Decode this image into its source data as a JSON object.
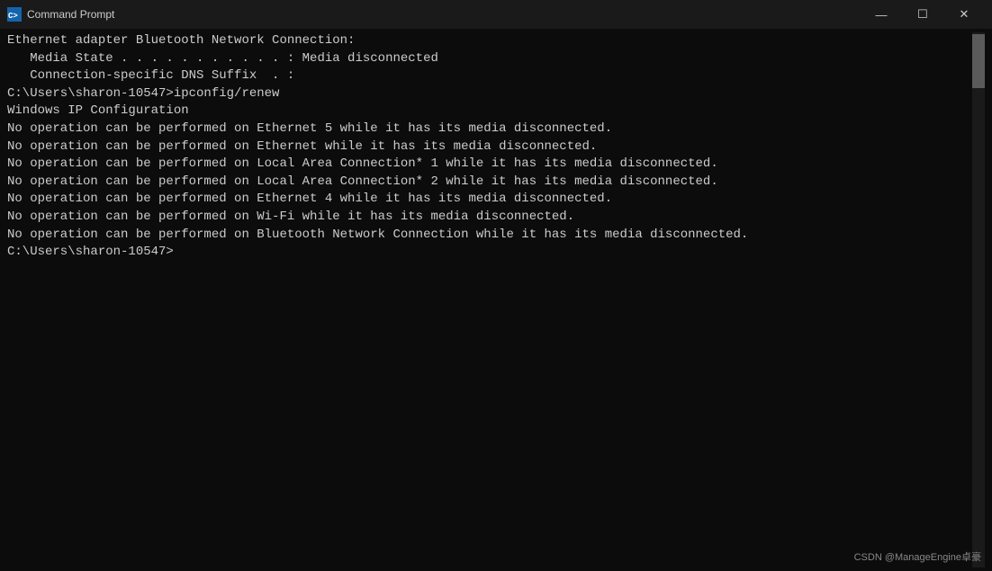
{
  "titleBar": {
    "icon": "cmd-icon",
    "title": "Command Prompt",
    "minimizeLabel": "—",
    "maximizeLabel": "☐",
    "closeLabel": "✕"
  },
  "terminal": {
    "lines": [
      "Ethernet adapter Bluetooth Network Connection:",
      "",
      "   Media State . . . . . . . . . . . : Media disconnected",
      "   Connection-specific DNS Suffix  . :",
      "",
      "C:\\Users\\sharon-10547>ipconfig/renew",
      "",
      "Windows IP Configuration",
      "",
      "No operation can be performed on Ethernet 5 while it has its media disconnected.",
      "No operation can be performed on Ethernet while it has its media disconnected.",
      "No operation can be performed on Local Area Connection* 1 while it has its media disconnected.",
      "No operation can be performed on Local Area Connection* 2 while it has its media disconnected.",
      "No operation can be performed on Ethernet 4 while it has its media disconnected.",
      "No operation can be performed on Wi-Fi while it has its media disconnected.",
      "No operation can be performed on Bluetooth Network Connection while it has its media disconnected.",
      "",
      "C:\\Users\\sharon-10547>"
    ]
  },
  "watermark": {
    "text": "CSDN @ManageEngine卓豪"
  }
}
